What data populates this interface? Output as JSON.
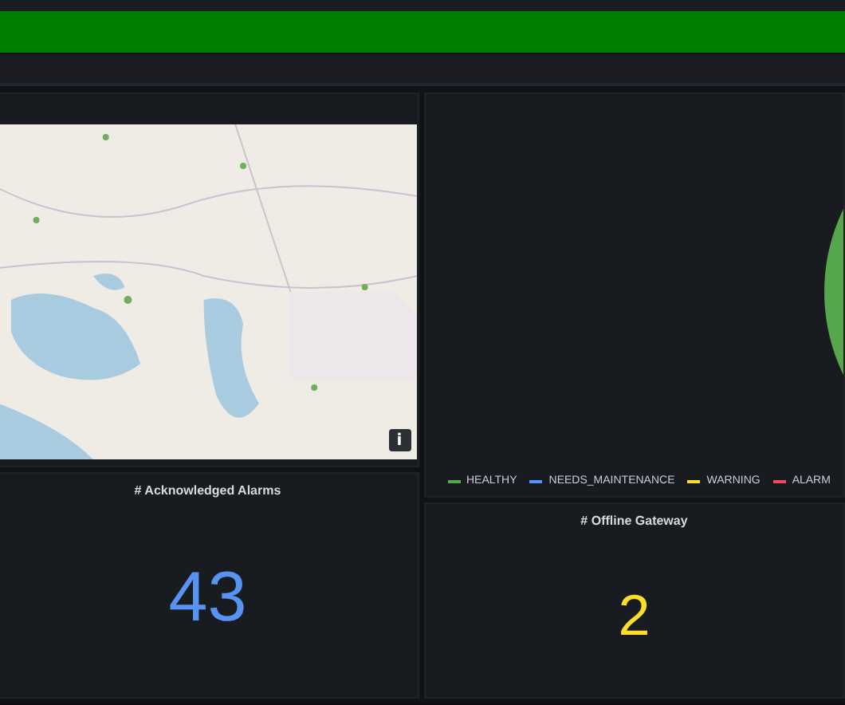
{
  "status_banner": {
    "color": "#008000"
  },
  "map_panel": {
    "info_button": "i"
  },
  "status_panel": {
    "legend": [
      {
        "label": "HEALTHY",
        "color": "#56a64b"
      },
      {
        "label": "NEEDS_MAINTENANCE",
        "color": "#5794f2"
      },
      {
        "label": "WARNING",
        "color": "#fade2a"
      },
      {
        "label": "ALARM",
        "color": "#f2495c"
      }
    ]
  },
  "stats": [
    {
      "title": "# Acknowledged Alarms",
      "value": "43",
      "color": "#5794f2"
    },
    {
      "title": "# Offline Gateway",
      "value": "2",
      "color": "#fade2a"
    }
  ]
}
